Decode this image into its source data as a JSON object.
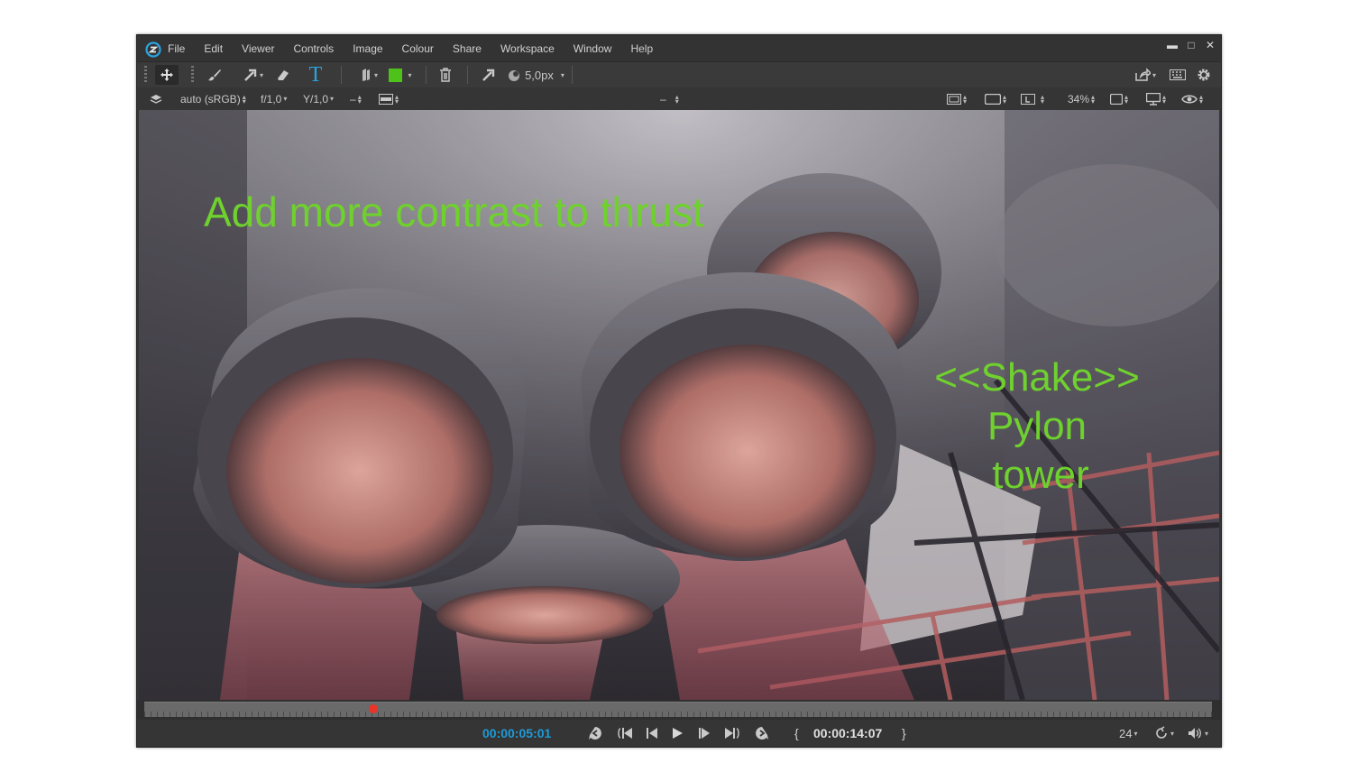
{
  "menu": [
    "File",
    "Edit",
    "Viewer",
    "Controls",
    "Image",
    "Colour",
    "Share",
    "Workspace",
    "Window",
    "Help"
  ],
  "window_controls": [
    "minimize-icon",
    "maximize-icon",
    "close-icon"
  ],
  "toolbar": {
    "brush_size": "5,0px",
    "color_swatch": "#4fc21a",
    "text_tool_glyph": "T"
  },
  "optbar": {
    "color_space": "auto (sRGB)",
    "fstop": "f/1,0",
    "gamma": "Y/1,0",
    "center_value": "–",
    "zoom": "34%"
  },
  "annotations": {
    "line1": "Add more contrast to thrust",
    "line2a": "<<Shake>>",
    "line2b": "Pylon",
    "line2c": "tower",
    "color": "#6fd12e"
  },
  "timeline": {
    "progress": 0.2143
  },
  "transport": {
    "current_time": "00:00:05:01",
    "end_time": "00:00:14:07",
    "fps": "24",
    "in_bracket": "{",
    "out_bracket": "}"
  }
}
